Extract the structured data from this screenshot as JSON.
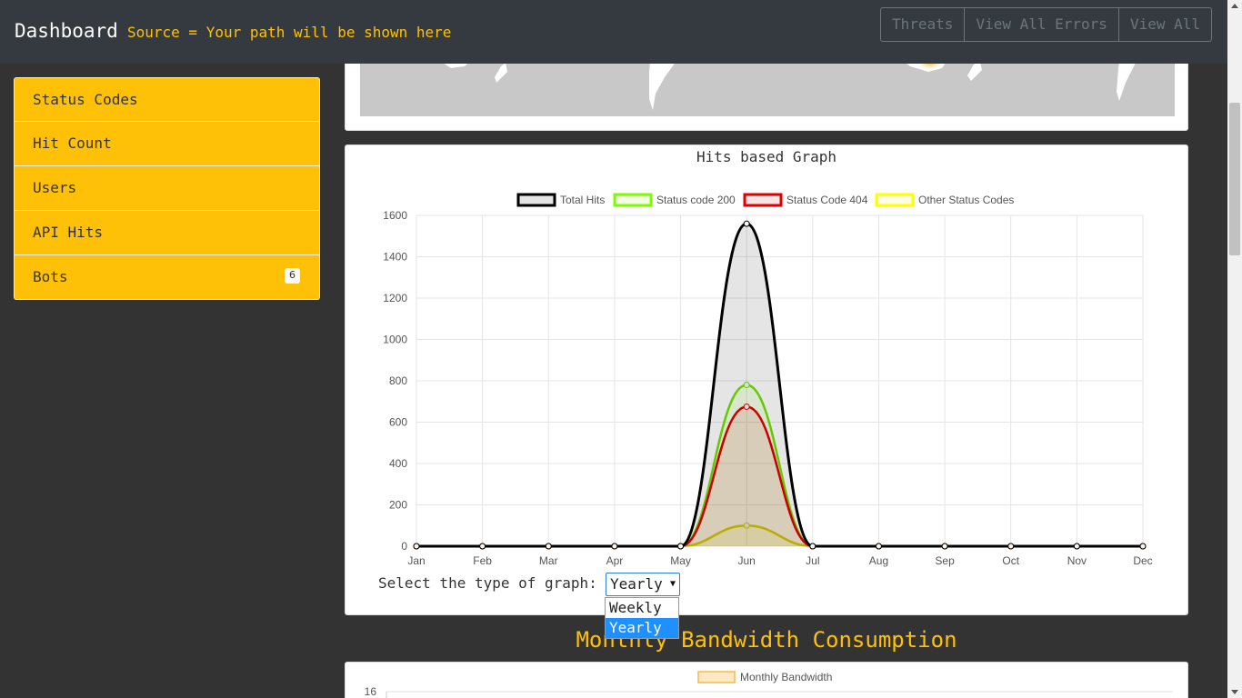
{
  "header": {
    "brand": "Dashboard",
    "source_text": "Source = Your path will be shown here",
    "buttons": [
      "Threats",
      "View All Errors",
      "View All"
    ]
  },
  "sidebar": {
    "items": [
      {
        "label": "Status Codes"
      },
      {
        "label": "Hit Count"
      },
      {
        "label": "Users"
      },
      {
        "label": "API Hits"
      },
      {
        "label": "Bots",
        "badge": "6"
      }
    ]
  },
  "graph": {
    "title": "Hits based Graph",
    "select_label": "Select the type of graph:",
    "select_value": "Yearly",
    "options": [
      {
        "label": "Weekly",
        "selected": false
      },
      {
        "label": "Yearly",
        "selected": true
      }
    ]
  },
  "bandwidth": {
    "title": "Monthly Bandwidth Consumption",
    "legend": "Monthly Bandwidth",
    "first_tick": "16"
  },
  "colors": {
    "accent": "#ffc107",
    "topbar": "#343a40",
    "background": "#333333"
  },
  "chart_data": {
    "type": "line",
    "title": "Hits based Graph",
    "categories": [
      "Jan",
      "Feb",
      "Mar",
      "Apr",
      "May",
      "Jun",
      "Jul",
      "Aug",
      "Sep",
      "Oct",
      "Nov",
      "Dec"
    ],
    "ylim": [
      0,
      1600
    ],
    "yticks": [
      0,
      200,
      400,
      600,
      800,
      1000,
      1200,
      1400,
      1600
    ],
    "grid": true,
    "legend_position": "top",
    "series": [
      {
        "name": "Total Hits",
        "color": "#000000",
        "fill": "rgba(0,0,0,0.1)",
        "values": [
          0,
          0,
          0,
          0,
          0,
          1560,
          0,
          0,
          0,
          0,
          0,
          0
        ]
      },
      {
        "name": "Status code 200",
        "color": "#7cfc00",
        "fill": "rgba(124,252,0,0.1)",
        "values": [
          0,
          0,
          0,
          0,
          0,
          780,
          0,
          0,
          0,
          0,
          0,
          0
        ]
      },
      {
        "name": "Status Code 404",
        "color": "#e00000",
        "fill": "rgba(224,0,0,0.1)",
        "values": [
          0,
          0,
          0,
          0,
          0,
          675,
          0,
          0,
          0,
          0,
          0,
          0
        ]
      },
      {
        "name": "Other Status Codes",
        "color": "#ffff00",
        "fill": "rgba(255,255,0,0.1)",
        "values": [
          0,
          0,
          0,
          0,
          0,
          100,
          0,
          0,
          0,
          0,
          0,
          0
        ]
      }
    ]
  }
}
